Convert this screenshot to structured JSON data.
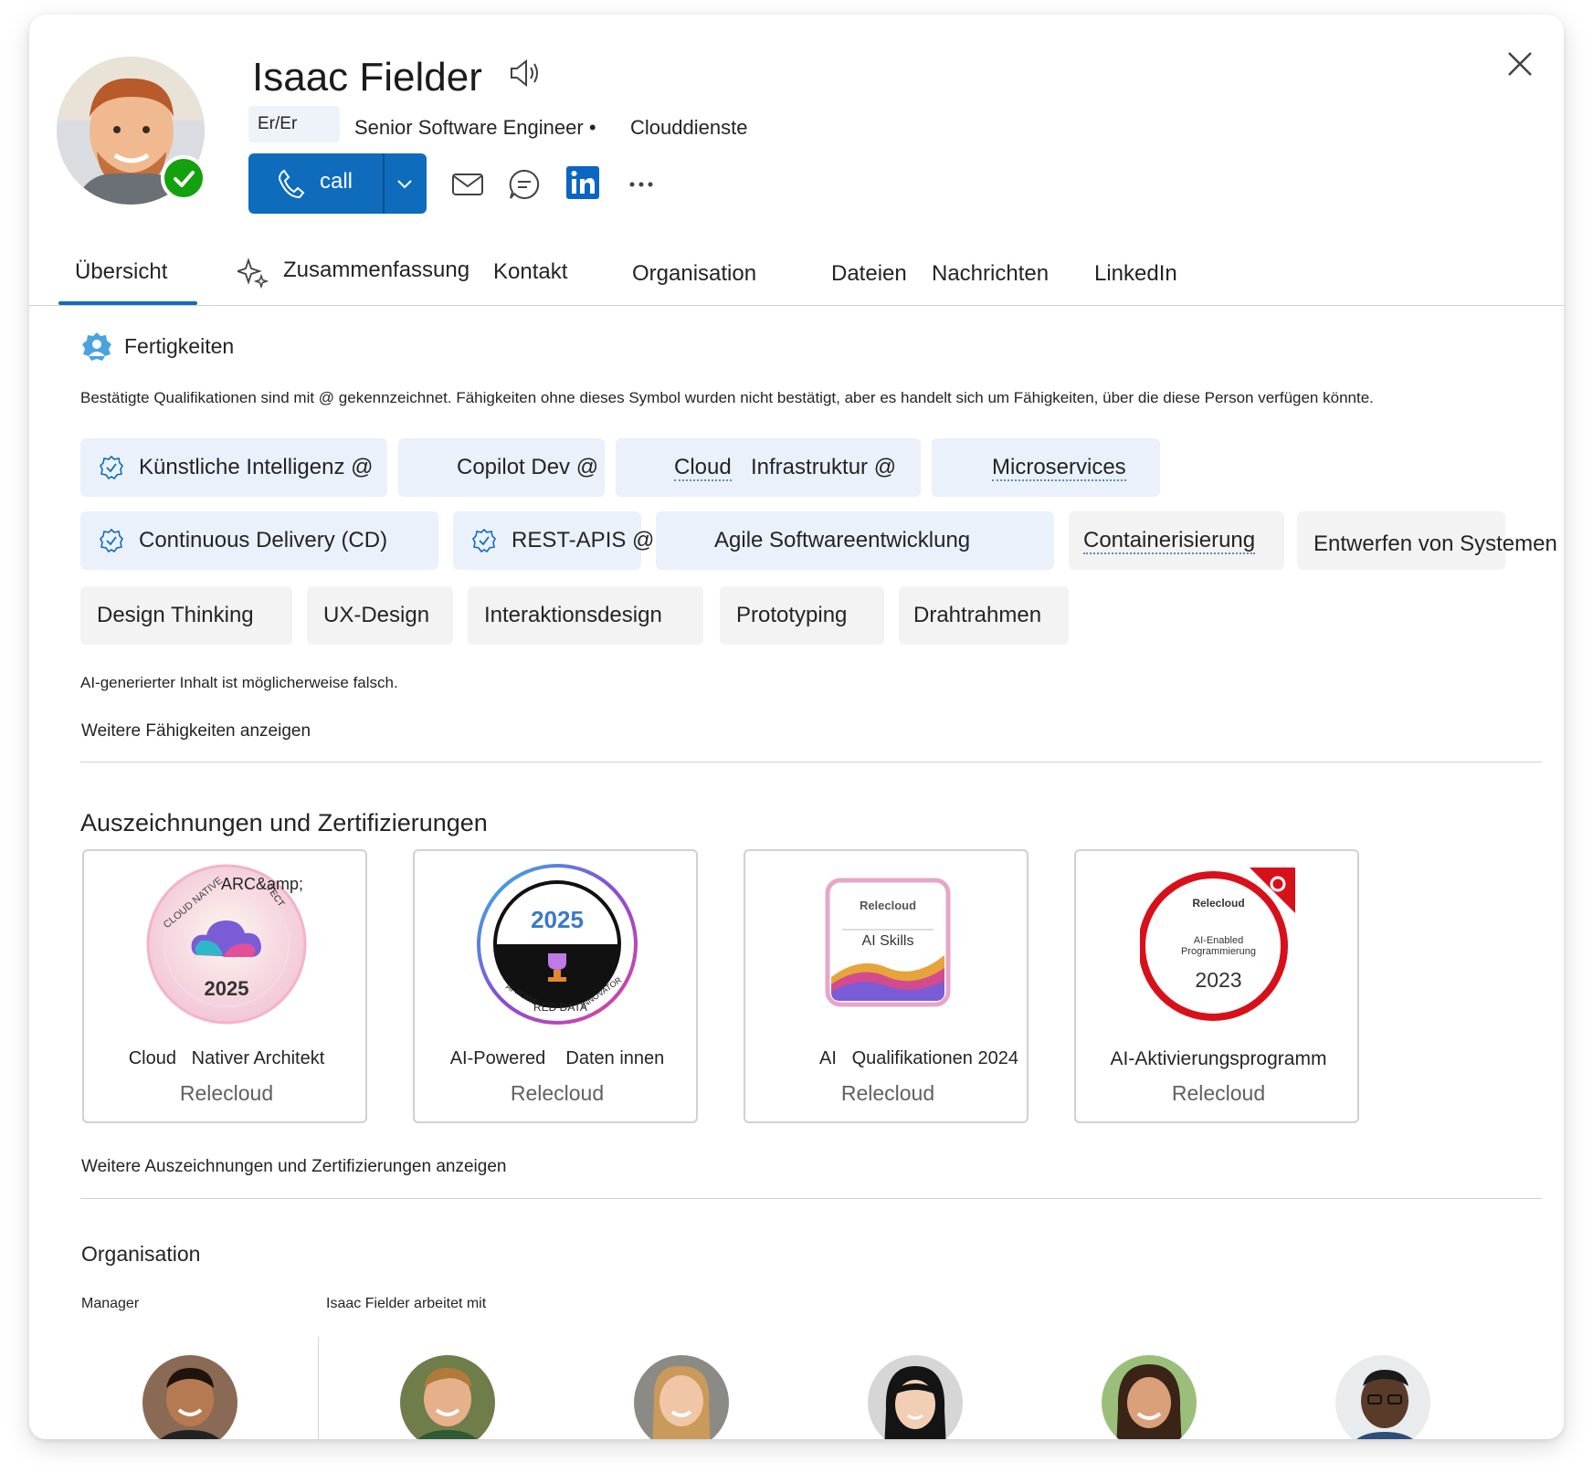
{
  "profile": {
    "name": "Isaac Fielder",
    "pronouns": "Er/Er",
    "job_title": "Senior Software Engineer •",
    "department": "Clouddienste",
    "call_label": "call"
  },
  "tabs": [
    {
      "label": "Übersicht"
    },
    {
      "label": "Zusammenfassung"
    },
    {
      "label": "Kontakt"
    },
    {
      "label": "Organisation"
    },
    {
      "label": "Dateien"
    },
    {
      "label": "Nachrichten"
    },
    {
      "label": "LinkedIn"
    }
  ],
  "skills": {
    "heading": "Fertigkeiten",
    "description": "Bestätigte Qualifikationen sind mit @ gekennzeichnet. Fähigkeiten ohne dieses Symbol wurden nicht bestätigt, aber es handelt sich um Fähigkeiten, über die diese Person verfügen könnte.",
    "items": [
      {
        "label": "Künstliche Intelligenz @"
      },
      {
        "label": "Copilot Dev @"
      },
      {
        "label": "Cloud",
        "label2": "Infrastruktur @"
      },
      {
        "label": "Microservices"
      },
      {
        "label": "Continuous Delivery (CD)"
      },
      {
        "label": "REST-APIS @"
      },
      {
        "label": "Agile Softwareentwicklung"
      },
      {
        "label": "Containerisierung"
      },
      {
        "label": "Entwerfen von Systemen"
      },
      {
        "label": "Design Thinking"
      },
      {
        "label": "UX-Design"
      },
      {
        "label": "Interaktionsdesign"
      },
      {
        "label": "Prototyping"
      },
      {
        "label": "Drahtrahmen"
      }
    ],
    "ai_note": "AI-generierter Inhalt ist möglicherweise falsch.",
    "more_link": "Weitere Fähigkeiten anzeigen"
  },
  "awards": {
    "heading": "Auszeichnungen und Zertifizierungen",
    "items": [
      {
        "title": "Cloud   Nativer Architekt",
        "org": "Relecloud",
        "badge_year": "2025",
        "badge_ring": "CLOUD NATIVE",
        "badge_ring2": "ARC&amp;",
        "badge_ring3": "TECT"
      },
      {
        "title": "AI-Powered    Daten innen",
        "org": "Relecloud",
        "badge_year": "2025",
        "badge_ring": "AI-POWE",
        "badge_ring2": "RED DATA",
        "badge_ring3": "INNOVATOR"
      },
      {
        "title": "AI   Qualifikationen 2024",
        "org": "Relecloud",
        "badge_brand": "Relecloud",
        "badge_name": "AI Skills"
      },
      {
        "title": "AI-Aktivierungsprogramm",
        "org": "Relecloud",
        "badge_brand": "Relecloud",
        "badge_line1": "AI-Enabled",
        "badge_line2": "Programmierung",
        "badge_year": "2023"
      }
    ],
    "more_link": "Weitere Auszeichnungen und Zertifizierungen anzeigen"
  },
  "organisation": {
    "heading": "Organisation",
    "manager_label": "Manager",
    "works_with_label": "Isaac Fielder arbeitet mit"
  },
  "colors": {
    "accent": "#0f6cbd",
    "presence": "#13a10e",
    "skill_blue": "#eaf1fb",
    "skill_gray": "#f3f3f3"
  }
}
